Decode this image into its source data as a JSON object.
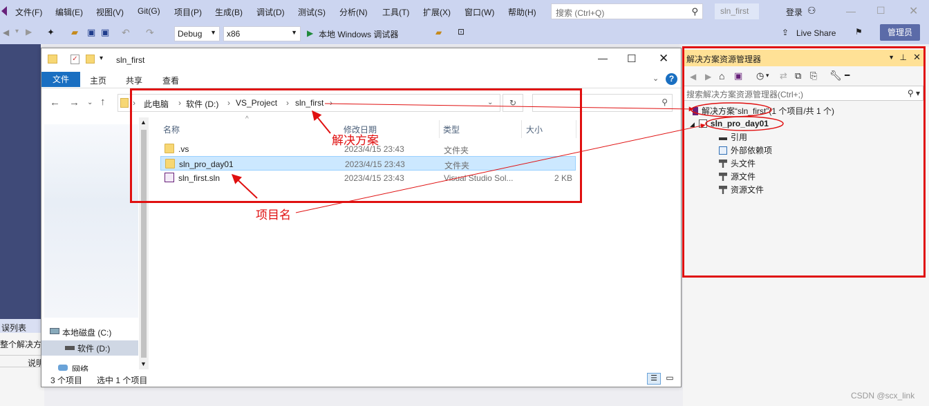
{
  "menubar": {
    "items": [
      "文件(F)",
      "编辑(E)",
      "视图(V)",
      "Git(G)",
      "项目(P)",
      "生成(B)",
      "调试(D)",
      "测试(S)",
      "分析(N)",
      "工具(T)",
      "扩展(X)",
      "窗口(W)",
      "帮助(H)"
    ],
    "search_placeholder": "搜索 (Ctrl+Q)",
    "solution_tab": "sln_first",
    "login": "登录"
  },
  "toolbar": {
    "config": "Debug",
    "platform": "x86",
    "run_label": "本地 Windows 调试器",
    "live_share": "Live Share",
    "admin": "管理员"
  },
  "explorer": {
    "window_title": "sln_first",
    "ribbon_tabs": [
      "文件",
      "主页",
      "共享",
      "查看"
    ],
    "breadcrumb": [
      "此电脑",
      "软件 (D:)",
      "VS_Project",
      "sln_first"
    ],
    "columns": [
      "名称",
      "修改日期",
      "类型",
      "大小"
    ],
    "files": [
      {
        "name": ".vs",
        "date": "2023/4/15 23:43",
        "type": "文件夹",
        "size": ""
      },
      {
        "name": "sln_pro_day01",
        "date": "2023/4/15 23:43",
        "type": "文件夹",
        "size": ""
      },
      {
        "name": "sln_first.sln",
        "date": "2023/4/15 23:43",
        "type": "Visual Studio Sol...",
        "size": "2 KB"
      }
    ],
    "nav_items": [
      "本地磁盘 (C:)",
      "软件 (D:)",
      "网络"
    ],
    "status_count": "3 个项目",
    "status_selected": "选中 1 个项目"
  },
  "error_panel": {
    "title": "误列表",
    "scope": "整个解决方案",
    "col": "说明"
  },
  "solution_explorer": {
    "title": "解决方案资源管理器",
    "search_placeholder": "搜索解决方案资源管理器(Ctrl+;)",
    "solution_node": "解决方案“sln_first”(1 个项目/共 1 个)",
    "project_node": "sln_pro_day01",
    "children": [
      "引用",
      "外部依赖项",
      "头文件",
      "源文件",
      "资源文件"
    ]
  },
  "annotations": {
    "solution": "解决方案",
    "project": "项目名"
  },
  "watermark": "CSDN @scx_link",
  "colors": {
    "annotation": "#e01010",
    "accent": "#1a6fc1",
    "vs_bar": "#ccd5f0"
  }
}
